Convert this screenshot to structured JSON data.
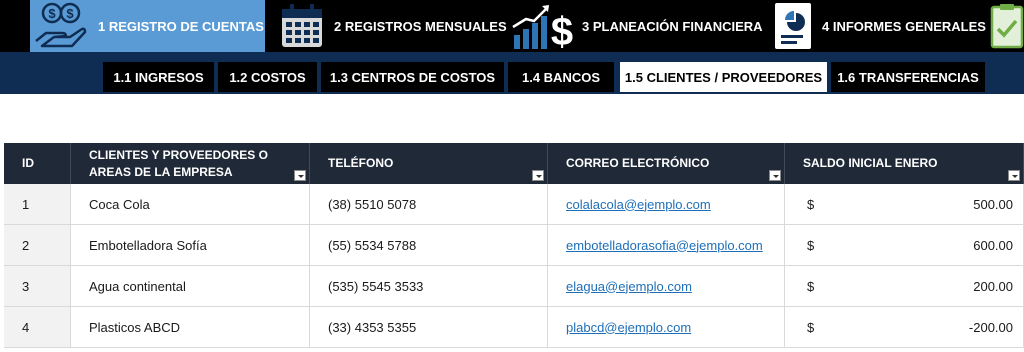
{
  "main_nav": [
    {
      "label": "1 REGISTRO DE CUENTAS",
      "icon": "money-hand-icon",
      "active": true
    },
    {
      "label": "2 REGISTROS MENSUALES",
      "icon": "calendar-icon",
      "active": false
    },
    {
      "label": "3 PLANEACIÓN FINANCIERA",
      "icon": "growth-chart-icon",
      "active": false
    },
    {
      "label": "4 INFORMES GENERALES",
      "icon": "report-icon",
      "active": false
    },
    {
      "label": "",
      "icon": "checklist-icon",
      "active": false
    }
  ],
  "sub_tabs": [
    {
      "label": "1.1 INGRESOS",
      "active": false
    },
    {
      "label": "1.2 COSTOS",
      "active": false
    },
    {
      "label": "1.3 CENTROS DE COSTOS",
      "active": false
    },
    {
      "label": "1.4 BANCOS",
      "active": false
    },
    {
      "label": "1.5 CLIENTES / PROVEEDORES",
      "active": true
    },
    {
      "label": "1.6 TRANSFERENCIAS",
      "active": false
    }
  ],
  "table": {
    "headers": {
      "id": "ID",
      "name_line1": "CLIENTES Y PROVEEDORES O",
      "name_line2": "AREAS DE LA EMPRESA",
      "phone": "TELÉFONO",
      "email": "CORREO ELECTRÓNICO",
      "balance": "SALDO INICIAL ENERO"
    },
    "rows": [
      {
        "id": "1",
        "name": "Coca Cola",
        "phone": "(38) 5510 5078",
        "email": "colalacola@ejemplo.com",
        "currency": "$",
        "balance": "500.00"
      },
      {
        "id": "2",
        "name": "Embotelladora Sofía",
        "phone": "(55) 5534 5788",
        "email": "embotelladorasofia@ejemplo.com",
        "currency": "$",
        "balance": "600.00"
      },
      {
        "id": "3",
        "name": "Agua continental",
        "phone": "(535) 5545 3533",
        "email": "elagua@ejemplo.com",
        "currency": "$",
        "balance": "200.00"
      },
      {
        "id": "4",
        "name": "Plasticos ABCD",
        "phone": "(33) 4353 5355",
        "email": "plabcd@ejemplo.com",
        "currency": "$",
        "balance": "-200.00"
      }
    ]
  },
  "colors": {
    "active_nav": "#5b9bd5",
    "sub_bar": "#0f2d52",
    "header": "#1f2937",
    "link": "#1f6fb8"
  }
}
